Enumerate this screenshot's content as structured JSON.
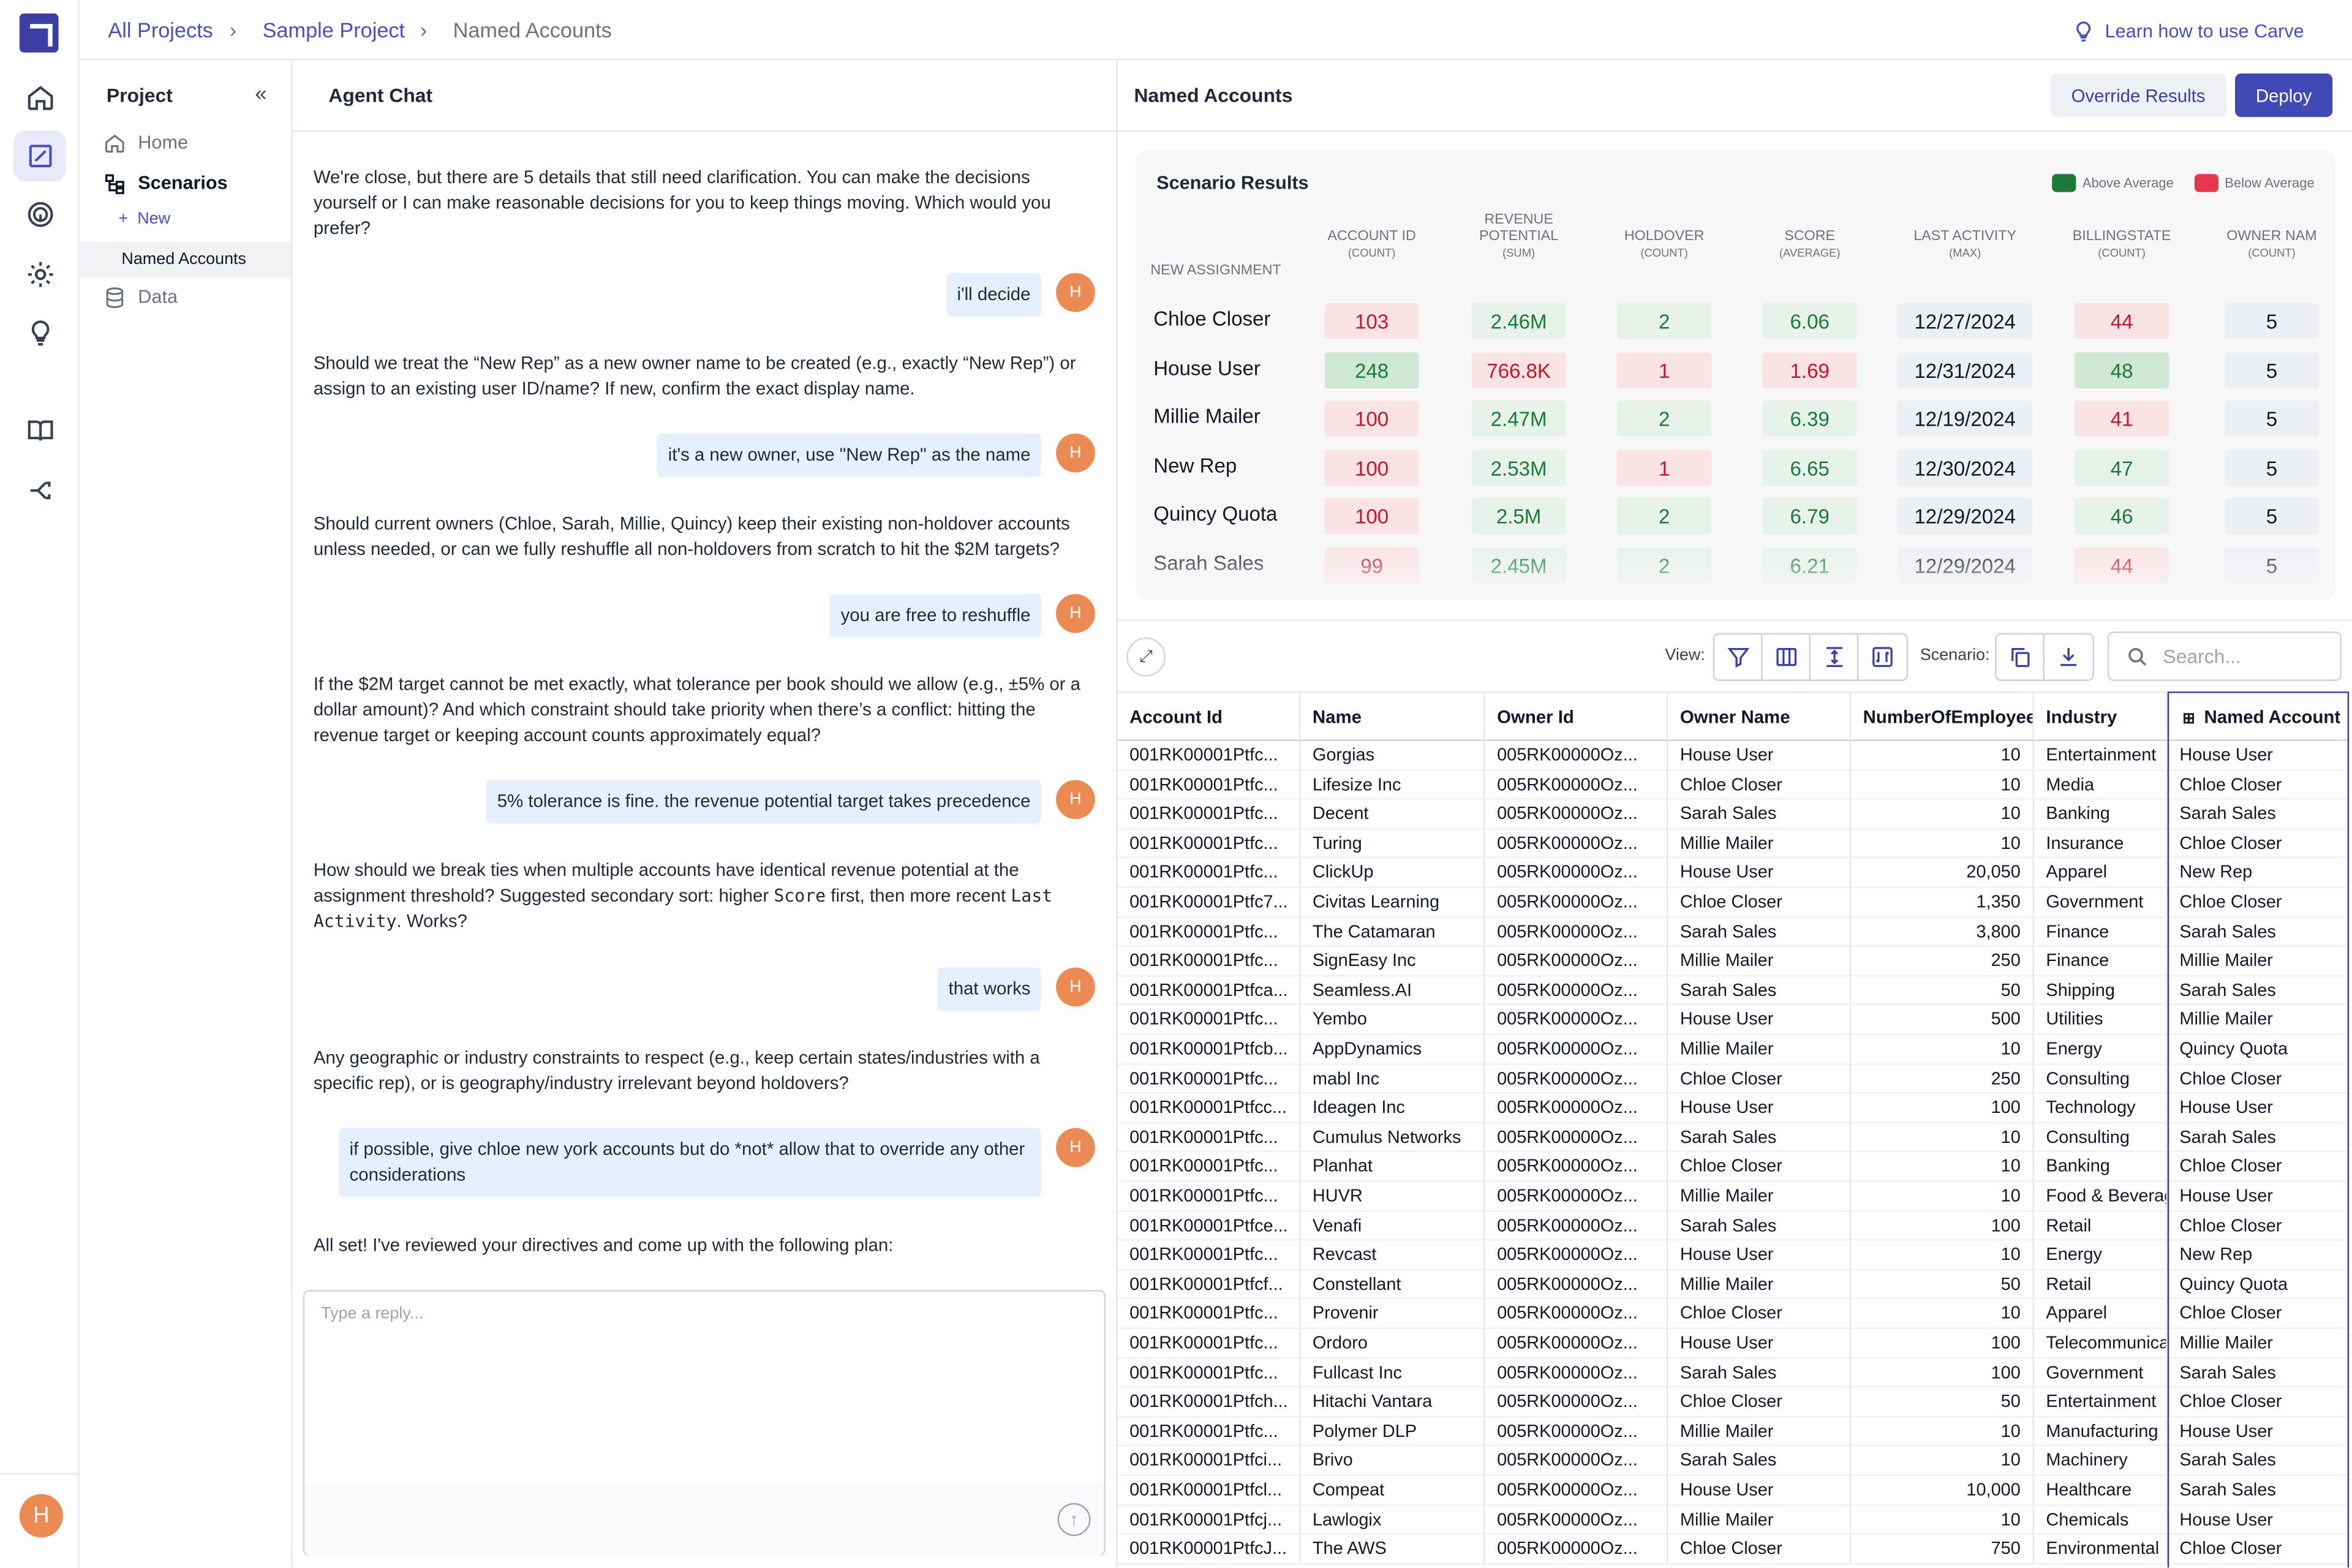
{
  "breadcrumb": [
    "All Projects",
    "Sample Project",
    "Named Accounts"
  ],
  "learn_link": "Learn how to use Carve",
  "project": {
    "title": "Project",
    "items": [
      "Home",
      "Scenarios",
      "Data"
    ],
    "new_label": "New",
    "sub_item": "Named Accounts"
  },
  "user_initial": "H",
  "chat": {
    "title": "Agent Chat",
    "messages": [
      {
        "role": "agent",
        "text": "We're close, but there are 5 details that still need clarification. You can make the decisions yourself or I can make reasonable decisions for you to keep things moving. Which would you prefer?"
      },
      {
        "role": "user",
        "text": "i'll decide"
      },
      {
        "role": "agent",
        "text": "Should we treat the “New Rep” as a new owner name to be created (e.g., exactly “New Rep”) or assign to an existing user ID/name? If new, confirm the exact display name."
      },
      {
        "role": "user",
        "text": "it's a new owner, use \"New Rep\" as the name"
      },
      {
        "role": "agent",
        "text": "Should current owners (Chloe, Sarah, Millie, Quincy) keep their existing non-holdover accounts unless needed, or can we fully reshuffle all non-holdovers from scratch to hit the $2M targets?"
      },
      {
        "role": "user",
        "text": "you are free to reshuffle"
      },
      {
        "role": "agent",
        "text": "If the $2M target cannot be met exactly, what tolerance per book should we allow (e.g., ±5% or a dollar amount)? And which constraint should take priority when there’s a conflict: hitting the revenue target or keeping account counts approximately equal?"
      },
      {
        "role": "user",
        "text": "5% tolerance is fine. the revenue potential target takes precedence"
      },
      {
        "role": "agent",
        "text_parts": [
          "How should we break ties when multiple accounts have identical revenue potential at the assignment threshold? Suggested secondary sort: higher ",
          "Score",
          " first, then more recent ",
          "Last Activity",
          ". Works?"
        ]
      },
      {
        "role": "user",
        "text": "that works"
      },
      {
        "role": "agent",
        "text": "Any geographic or industry constraints to respect (e.g., keep certain states/industries with a specific rep), or is geography/industry irrelevant beyond holdovers?"
      },
      {
        "role": "user",
        "text": "if possible, give chloe new york accounts but do *not* allow that to override any other considerations"
      },
      {
        "role": "agent",
        "text": "All set! I've reviewed your directives and come up with the following plan:"
      }
    ],
    "reply_placeholder": "Type a reply..."
  },
  "panel": {
    "title": "Named Accounts",
    "override_label": "Override Results",
    "deploy_label": "Deploy"
  },
  "scenario": {
    "title": "Scenario Results",
    "legend": [
      {
        "label": "Above Average",
        "color": "#1b7a36"
      },
      {
        "label": "Below Average",
        "color": "#e5384f"
      }
    ],
    "first_col": "NEW ASSIGNMENT",
    "columns": [
      {
        "name": "ACCOUNT ID",
        "agg": "(COUNT)"
      },
      {
        "name": "REVENUE POTENTIAL",
        "agg": "(SUM)"
      },
      {
        "name": "HOLDOVER",
        "agg": "(COUNT)"
      },
      {
        "name": "SCORE",
        "agg": "(AVERAGE)"
      },
      {
        "name": "LAST ACTIVITY",
        "agg": "(MAX)"
      },
      {
        "name": "BILLINGSTATE",
        "agg": "(COUNT)"
      },
      {
        "name": "OWNER NAM",
        "agg": "(COUNT)"
      }
    ],
    "rows": [
      {
        "label": "Chloe Closer",
        "cells": [
          [
            "103",
            "red"
          ],
          [
            "2.46M",
            "green"
          ],
          [
            "2",
            "green"
          ],
          [
            "6.06",
            "green"
          ],
          [
            "12/27/2024",
            "grey"
          ],
          [
            "44",
            "red"
          ],
          [
            "5",
            "grey"
          ]
        ]
      },
      {
        "label": "House User",
        "cells": [
          [
            "248",
            "gd"
          ],
          [
            "766.8K",
            "red"
          ],
          [
            "1",
            "red"
          ],
          [
            "1.69",
            "red"
          ],
          [
            "12/31/2024",
            "grey"
          ],
          [
            "48",
            "gd"
          ],
          [
            "5",
            "grey"
          ]
        ]
      },
      {
        "label": "Millie Mailer",
        "cells": [
          [
            "100",
            "red"
          ],
          [
            "2.47M",
            "green"
          ],
          [
            "2",
            "green"
          ],
          [
            "6.39",
            "green"
          ],
          [
            "12/19/2024",
            "grey"
          ],
          [
            "41",
            "red"
          ],
          [
            "5",
            "grey"
          ]
        ]
      },
      {
        "label": "New Rep",
        "cells": [
          [
            "100",
            "red"
          ],
          [
            "2.53M",
            "green"
          ],
          [
            "1",
            "red"
          ],
          [
            "6.65",
            "green"
          ],
          [
            "12/30/2024",
            "grey"
          ],
          [
            "47",
            "green"
          ],
          [
            "5",
            "grey"
          ]
        ]
      },
      {
        "label": "Quincy Quota",
        "cells": [
          [
            "100",
            "red"
          ],
          [
            "2.5M",
            "green"
          ],
          [
            "2",
            "green"
          ],
          [
            "6.79",
            "green"
          ],
          [
            "12/29/2024",
            "grey"
          ],
          [
            "46",
            "green"
          ],
          [
            "5",
            "grey"
          ]
        ]
      },
      {
        "label": "Sarah Sales",
        "cells": [
          [
            "99",
            "red"
          ],
          [
            "2.45M",
            "green"
          ],
          [
            "2",
            "green"
          ],
          [
            "6.21",
            "green"
          ],
          [
            "12/29/2024",
            "grey"
          ],
          [
            "44",
            "red"
          ],
          [
            "5",
            "grey"
          ]
        ]
      }
    ]
  },
  "toolbar": {
    "view_label": "View:",
    "scenario_label": "Scenario:",
    "search_placeholder": "Search..."
  },
  "table": {
    "headers": [
      "Account Id",
      "Name",
      "Owner Id",
      "Owner Name",
      "NumberOfEmployees",
      "Industry",
      "Named Account"
    ],
    "rows": [
      [
        "001RK00001Ptfc...",
        "Gorgias",
        "005RK00000Oz...",
        "House User",
        "10",
        "Entertainment",
        "House User"
      ],
      [
        "001RK00001Ptfc...",
        "Lifesize Inc",
        "005RK00000Oz...",
        "Chloe Closer",
        "10",
        "Media",
        "Chloe Closer"
      ],
      [
        "001RK00001Ptfc...",
        "Decent",
        "005RK00000Oz...",
        "Sarah Sales",
        "10",
        "Banking",
        "Sarah Sales"
      ],
      [
        "001RK00001Ptfc...",
        "Turing",
        "005RK00000Oz...",
        "Millie Mailer",
        "10",
        "Insurance",
        "Chloe Closer"
      ],
      [
        "001RK00001Ptfc...",
        "ClickUp",
        "005RK00000Oz...",
        "House User",
        "20,050",
        "Apparel",
        "New Rep"
      ],
      [
        "001RK00001Ptfc7...",
        "Civitas Learning",
        "005RK00000Oz...",
        "Chloe Closer",
        "1,350",
        "Government",
        "Chloe Closer"
      ],
      [
        "001RK00001Ptfc...",
        "The Catamaran",
        "005RK00000Oz...",
        "Sarah Sales",
        "3,800",
        "Finance",
        "Sarah Sales"
      ],
      [
        "001RK00001Ptfc...",
        "SignEasy Inc",
        "005RK00000Oz...",
        "Millie Mailer",
        "250",
        "Finance",
        "Millie Mailer"
      ],
      [
        "001RK00001Ptfca...",
        "Seamless.AI",
        "005RK00000Oz...",
        "Sarah Sales",
        "50",
        "Shipping",
        "Sarah Sales"
      ],
      [
        "001RK00001Ptfc...",
        "Yembo",
        "005RK00000Oz...",
        "House User",
        "500",
        "Utilities",
        "Millie Mailer"
      ],
      [
        "001RK00001Ptfcb...",
        "AppDynamics",
        "005RK00000Oz...",
        "Millie Mailer",
        "10",
        "Energy",
        "Quincy Quota"
      ],
      [
        "001RK00001Ptfc...",
        "mabl Inc",
        "005RK00000Oz...",
        "Chloe Closer",
        "250",
        "Consulting",
        "Chloe Closer"
      ],
      [
        "001RK00001Ptfcc...",
        "Ideagen Inc",
        "005RK00000Oz...",
        "House User",
        "100",
        "Technology",
        "House User"
      ],
      [
        "001RK00001Ptfc...",
        "Cumulus Networks",
        "005RK00000Oz...",
        "Sarah Sales",
        "10",
        "Consulting",
        "Sarah Sales"
      ],
      [
        "001RK00001Ptfc...",
        "Planhat",
        "005RK00000Oz...",
        "Chloe Closer",
        "10",
        "Banking",
        "Chloe Closer"
      ],
      [
        "001RK00001Ptfc...",
        "HUVR",
        "005RK00000Oz...",
        "Millie Mailer",
        "10",
        "Food & Beverage",
        "House User"
      ],
      [
        "001RK00001Ptfce...",
        "Venafi",
        "005RK00000Oz...",
        "Sarah Sales",
        "100",
        "Retail",
        "Chloe Closer"
      ],
      [
        "001RK00001Ptfc...",
        "Revcast",
        "005RK00000Oz...",
        "House User",
        "10",
        "Energy",
        "New Rep"
      ],
      [
        "001RK00001Ptfcf...",
        "Constellant",
        "005RK00000Oz...",
        "Millie Mailer",
        "50",
        "Retail",
        "Quincy Quota"
      ],
      [
        "001RK00001Ptfc...",
        "Provenir",
        "005RK00000Oz...",
        "Chloe Closer",
        "10",
        "Apparel",
        "Chloe Closer"
      ],
      [
        "001RK00001Ptfc...",
        "Ordoro",
        "005RK00000Oz...",
        "House User",
        "100",
        "Telecommunications",
        "Millie Mailer"
      ],
      [
        "001RK00001Ptfc...",
        "Fullcast Inc",
        "005RK00000Oz...",
        "Sarah Sales",
        "100",
        "Government",
        "Sarah Sales"
      ],
      [
        "001RK00001Ptfch...",
        "Hitachi Vantara",
        "005RK00000Oz...",
        "Chloe Closer",
        "50",
        "Entertainment",
        "Chloe Closer"
      ],
      [
        "001RK00001Ptfc...",
        "Polymer DLP",
        "005RK00000Oz...",
        "Millie Mailer",
        "10",
        "Manufacturing",
        "House User"
      ],
      [
        "001RK00001Ptfci...",
        "Brivo",
        "005RK00000Oz...",
        "Sarah Sales",
        "10",
        "Machinery",
        "Sarah Sales"
      ],
      [
        "001RK00001Ptfcl...",
        "Compeat",
        "005RK00000Oz...",
        "House User",
        "10,000",
        "Healthcare",
        "Sarah Sales"
      ],
      [
        "001RK00001Ptfcj...",
        "Lawlogix",
        "005RK00000Oz...",
        "Millie Mailer",
        "10",
        "Chemicals",
        "House User"
      ],
      [
        "001RK00001PtfcJ...",
        "The AWS",
        "005RK00000Oz...",
        "Chloe Closer",
        "750",
        "Environmental",
        "Chloe Closer"
      ]
    ]
  }
}
